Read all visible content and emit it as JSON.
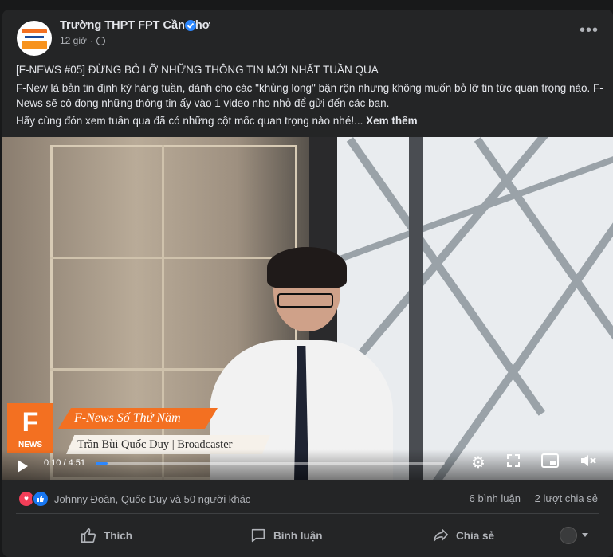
{
  "post": {
    "author": "Trường THPT FPT Cần Thơ",
    "time": "12 giờ",
    "headline": "[F-NEWS #05] ĐỪNG BỎ LỠ NHỮNG THÔNG TIN MỚI NHẤT TUẦN QUA",
    "body": "F-New là bản tin định kỳ hàng tuần, dành cho các \"khủng long\" bận rộn nhưng không muốn bỏ lỡ tin tức quan trọng nào. F-News sẽ cô đọng những thông tin ấy vào 1 video nho nhỏ để gửi đến các bạn.",
    "teaser": "Hãy cùng đón xem tuần qua đã có những cột mốc quan trọng nào nhé!...",
    "see_more": "Xem thêm"
  },
  "video": {
    "logo_letter": "F",
    "logo_sub": "NEWS",
    "title": "F-News Số Thứ Năm",
    "presenter": "Trần Bùi Quốc Duy  |  Broadcaster",
    "time_display": "0:10 / 4:51",
    "progress_fraction": 0.034
  },
  "engagement": {
    "reaction_names": "Johnny Đoàn, Quốc Duy và 50 người khác",
    "comments": "6 bình luận",
    "shares": "2 lượt chia sẻ"
  },
  "actions": {
    "like": "Thích",
    "comment": "Bình luận",
    "share": "Chia sẻ"
  },
  "colors": {
    "accent": "#f37021",
    "fb_blue": "#2d88ff",
    "card": "#242526"
  }
}
